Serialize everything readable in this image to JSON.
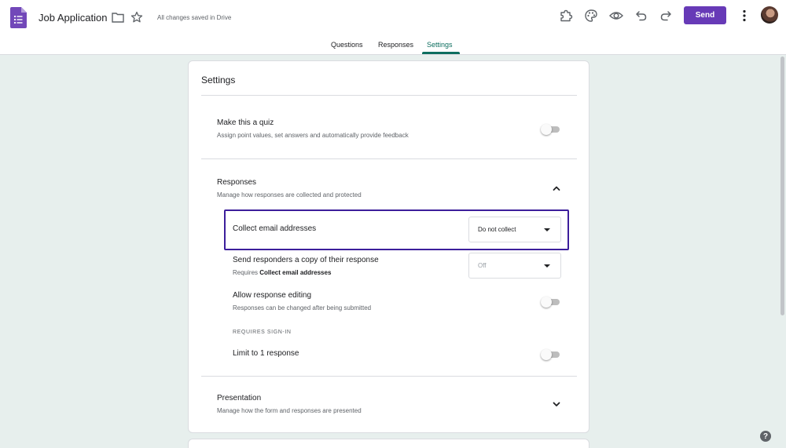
{
  "header": {
    "title": "Job Application",
    "save_status": "All changes saved in Drive",
    "send_label": "Send"
  },
  "tabs": [
    {
      "label": "Questions"
    },
    {
      "label": "Responses"
    },
    {
      "label": "Settings",
      "active": true
    }
  ],
  "settings": {
    "title": "Settings",
    "quiz": {
      "title": "Make this a quiz",
      "subtitle": "Assign point values, set answers and automatically provide feedback"
    },
    "responses": {
      "title": "Responses",
      "subtitle": "Manage how responses are collected and protected",
      "collect_email": {
        "label": "Collect email addresses",
        "value": "Do not collect"
      },
      "send_copy": {
        "label": "Send responders a copy of their response",
        "requires_prefix": "Requires ",
        "requires_bold": "Collect email addresses",
        "value": "Off"
      },
      "allow_editing": {
        "label": "Allow response editing",
        "subtitle": "Responses can be changed after being submitted"
      },
      "requires_signin_caption": "REQUIRES SIGN-IN",
      "limit_one": {
        "label": "Limit to 1 response"
      }
    },
    "presentation": {
      "title": "Presentation",
      "subtitle": "Manage how the form and responses are presented"
    }
  },
  "colors": {
    "accent": "#673ab7",
    "tab_active": "#0d6e5f",
    "highlight_border": "#3c1e9b",
    "background": "#e7efed"
  },
  "icons": [
    "forms-app-icon",
    "folder-icon",
    "star-icon",
    "addon-icon",
    "palette-icon",
    "preview-eye-icon",
    "undo-icon",
    "redo-icon",
    "more-vert-icon",
    "help-icon",
    "chevron-up-icon",
    "chevron-down-icon",
    "dropdown-caret-icon"
  ]
}
